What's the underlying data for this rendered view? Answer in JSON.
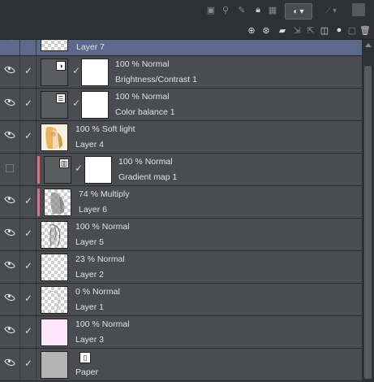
{
  "toolbar": {
    "icons_top": [
      "clip-icon",
      "ref-icon",
      "draft-icon",
      "lock-icon",
      "alpha-lock-icon",
      "mask-icon"
    ],
    "blend_mode_icon": "blend-icon",
    "opacity_icon": "opacity-icon",
    "icons_second": [
      "new-raster-icon",
      "new-vector-icon",
      "new-folder-icon",
      "transfer-icon",
      "merge-icon",
      "mask-create-icon",
      "mask-apply-icon",
      "delete-icon"
    ]
  },
  "layers": [
    {
      "blend": "",
      "name": "Layer 7",
      "thumb": "checker",
      "visible": true,
      "selected": true,
      "clipped": false
    },
    {
      "blend": "100 % Normal",
      "name": "Brightness/Contrast 1",
      "thumb": "adjust",
      "icon": "brightness-contrast-icon",
      "visible": true,
      "clipped": false,
      "mask": true
    },
    {
      "blend": "100 % Normal",
      "name": "Color balance 1",
      "thumb": "adjust",
      "icon": "color-balance-icon",
      "visible": true,
      "clipped": false,
      "mask": true
    },
    {
      "blend": "100 % Soft light",
      "name": "Layer 4",
      "thumb": "art",
      "visible": true,
      "clipped": false
    },
    {
      "blend": "100 % Normal",
      "name": "Gradient map 1",
      "thumb": "adjust",
      "icon": "gradient-map-icon",
      "visible": false,
      "clipped": true,
      "mask": true
    },
    {
      "blend": "74 % Multiply",
      "name": "Layer 6",
      "thumb": "gray",
      "visible": true,
      "clipped": true
    },
    {
      "blend": "100 % Normal",
      "name": "Layer 5",
      "thumb": "checker",
      "visible": true,
      "clipped": false
    },
    {
      "blend": "23 % Normal",
      "name": "Layer 2",
      "thumb": "checker",
      "visible": true,
      "clipped": false
    },
    {
      "blend": "0 % Normal",
      "name": "Layer 1",
      "thumb": "checker",
      "visible": true,
      "clipped": false
    },
    {
      "blend": "100 % Normal",
      "name": "Layer 3",
      "thumb": "pink",
      "visible": true,
      "clipped": false
    },
    {
      "blend": "",
      "name": "Paper",
      "thumb": "paper",
      "visible": true,
      "clipped": false
    }
  ],
  "colors": {
    "selected_row": "#5b6a8a",
    "clip_bar": "#d4747b",
    "row_bg": "#4a4c52"
  }
}
